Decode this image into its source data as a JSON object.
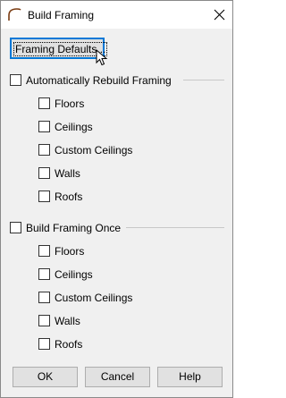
{
  "window": {
    "title": "Build Framing"
  },
  "icons": {
    "app": "arch-icon",
    "close": "close-icon",
    "cursor": "pointer-cursor-icon"
  },
  "defaults_button": {
    "label": "Framing Defaults..."
  },
  "auto_rebuild": {
    "label": "Automatically Rebuild Framing",
    "checked": false,
    "items": [
      {
        "label": "Floors",
        "checked": false
      },
      {
        "label": "Ceilings",
        "checked": false
      },
      {
        "label": "Custom Ceilings",
        "checked": false
      },
      {
        "label": "Walls",
        "checked": false
      },
      {
        "label": "Roofs",
        "checked": false
      }
    ]
  },
  "build_once": {
    "label": "Build Framing Once",
    "checked": false,
    "items": [
      {
        "label": "Floors",
        "checked": false
      },
      {
        "label": "Ceilings",
        "checked": false
      },
      {
        "label": "Custom Ceilings",
        "checked": false
      },
      {
        "label": "Walls",
        "checked": false
      },
      {
        "label": "Roofs",
        "checked": false
      }
    ]
  },
  "buttons": {
    "ok": "OK",
    "cancel": "Cancel",
    "help": "Help"
  }
}
